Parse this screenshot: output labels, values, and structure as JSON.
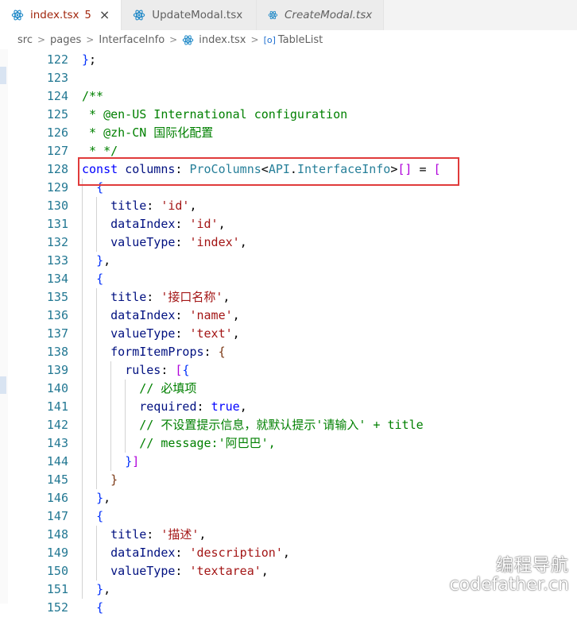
{
  "tabs": [
    {
      "label": "index.tsx",
      "badge": "5",
      "active": true
    },
    {
      "label": "UpdateModal.tsx",
      "active": false
    },
    {
      "label": "CreateModal.tsx",
      "active": false
    }
  ],
  "breadcrumb": {
    "items": [
      "src",
      "pages",
      "InterfaceInfo",
      "index.tsx",
      "TableList"
    ],
    "symbol_glyph": "[o]"
  },
  "editor": {
    "lines": [
      {
        "n": "122",
        "html": "<span class='b1'>}</span>;"
      },
      {
        "n": "123",
        "html": ""
      },
      {
        "n": "124",
        "html": "<span class='c'>/**</span>"
      },
      {
        "n": "125",
        "html": "<span class='c'> * @en-US International configuration</span>"
      },
      {
        "n": "126",
        "html": "<span class='c'> * @zh-CN 国际化配置</span>"
      },
      {
        "n": "127",
        "html": "<span class='c'> * */</span>"
      },
      {
        "n": "128",
        "html": "<span class='k'>const</span> <span class='p'>columns</span>: <span class='t'>ProColumns</span>&lt;<span class='t'>API</span>.<span class='t'>InterfaceInfo</span>&gt;<span class='pk'>[]</span> = <span class='pk'>[</span>"
      },
      {
        "n": "129",
        "html": "  <span class='b1'>{</span>"
      },
      {
        "n": "130",
        "html": "    <span class='p'>title</span>: <span class='s'>'id'</span>,"
      },
      {
        "n": "131",
        "html": "    <span class='p'>dataIndex</span>: <span class='s'>'id'</span>,"
      },
      {
        "n": "132",
        "html": "    <span class='p'>valueType</span>: <span class='s'>'index'</span>,"
      },
      {
        "n": "133",
        "html": "  <span class='b1'>}</span>,"
      },
      {
        "n": "134",
        "html": "  <span class='b1'>{</span>"
      },
      {
        "n": "135",
        "html": "    <span class='p'>title</span>: <span class='s'>'接口名称'</span>,"
      },
      {
        "n": "136",
        "html": "    <span class='p'>dataIndex</span>: <span class='s'>'name'</span>,"
      },
      {
        "n": "137",
        "html": "    <span class='p'>valueType</span>: <span class='s'>'text'</span>,"
      },
      {
        "n": "138",
        "html": "    <span class='p'>formItemProps</span>: <span class='b3'>{</span>"
      },
      {
        "n": "139",
        "html": "      <span class='p'>rules</span>: <span class='pk'>[</span><span class='b1'>{</span>"
      },
      {
        "n": "140",
        "html": "        <span class='c'>// 必填项</span>"
      },
      {
        "n": "141",
        "html": "        <span class='p'>required</span>: <span class='k'>true</span>,"
      },
      {
        "n": "142",
        "html": "        <span class='c'>// 不设置提示信息，就默认提示'请输入' + title</span>"
      },
      {
        "n": "143",
        "html": "        <span class='c'>// message:'阿巴巴',</span>"
      },
      {
        "n": "144",
        "html": "      <span class='b1'>}</span><span class='pk'>]</span>"
      },
      {
        "n": "145",
        "html": "    <span class='b3'>}</span>"
      },
      {
        "n": "146",
        "html": "  <span class='b1'>}</span>,"
      },
      {
        "n": "147",
        "html": "  <span class='b1'>{</span>"
      },
      {
        "n": "148",
        "html": "    <span class='p'>title</span>: <span class='s'>'描述'</span>,"
      },
      {
        "n": "149",
        "html": "    <span class='p'>dataIndex</span>: <span class='s'>'description'</span>,"
      },
      {
        "n": "150",
        "html": "    <span class='p'>valueType</span>: <span class='s'>'textarea'</span>,"
      },
      {
        "n": "151",
        "html": "  <span class='b1'>}</span>,"
      },
      {
        "n": "152",
        "html": "  <span class='b1'>{</span>"
      }
    ]
  },
  "watermark": {
    "line1": "编程导航",
    "line2": "codefather.cn"
  },
  "colors": {
    "accent_box": "#e03b3b",
    "react_icon": "#1e88c7"
  }
}
